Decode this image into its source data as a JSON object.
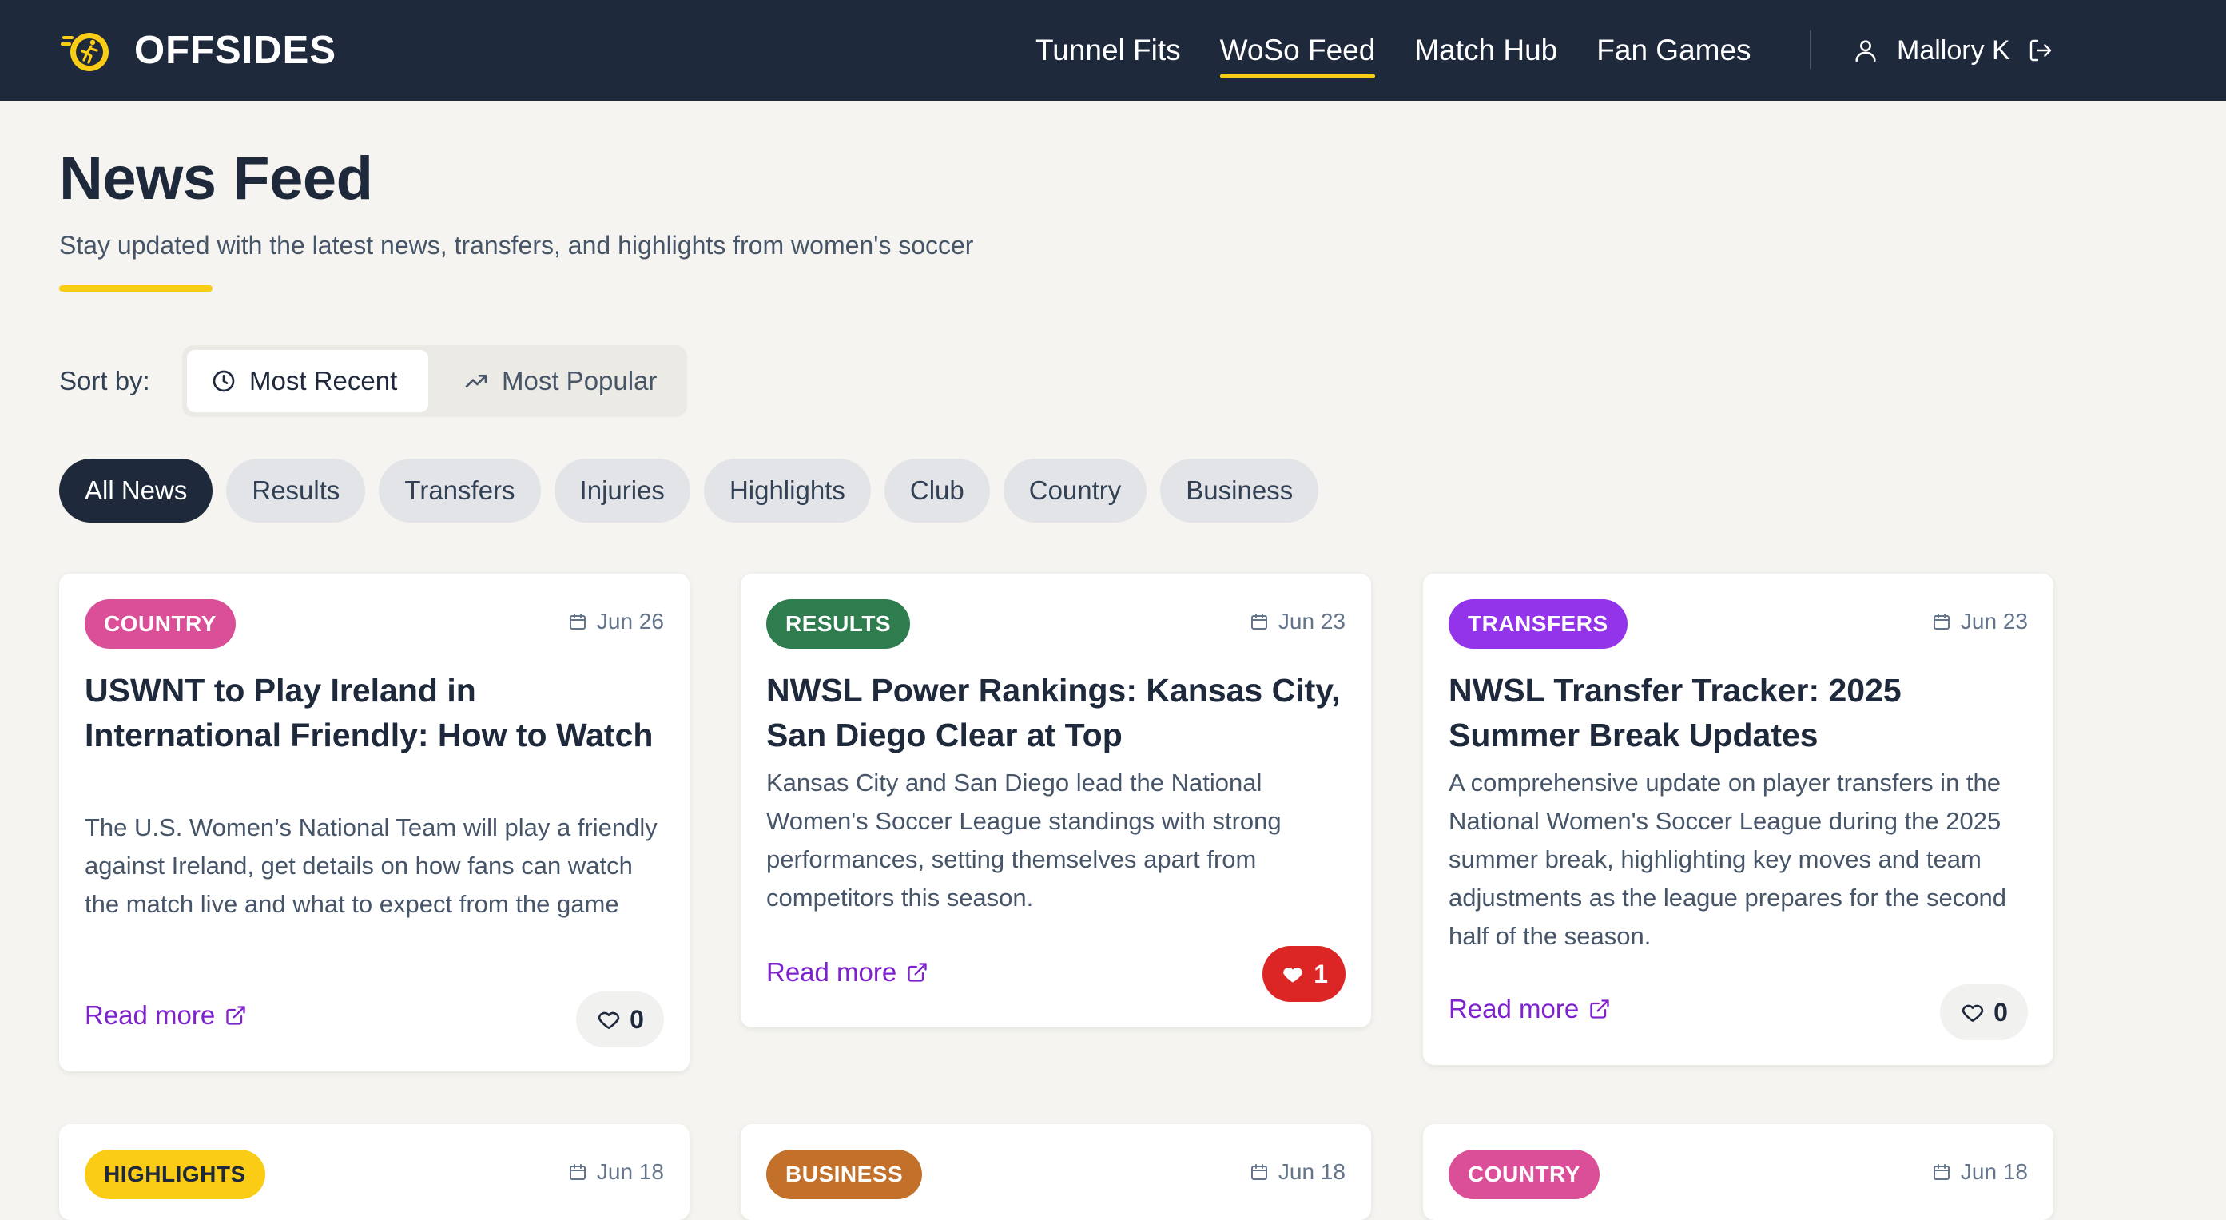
{
  "brand": {
    "name": "OFFSIDES"
  },
  "nav": {
    "items": [
      {
        "label": "Tunnel Fits",
        "active": false
      },
      {
        "label": "WoSo Feed",
        "active": true
      },
      {
        "label": "Match Hub",
        "active": false
      },
      {
        "label": "Fan Games",
        "active": false
      }
    ],
    "user_name": "Mallory K"
  },
  "page": {
    "title": "News Feed",
    "subtitle": "Stay updated with the latest news, transfers, and highlights from women's soccer"
  },
  "sort": {
    "label": "Sort by:",
    "options": [
      {
        "label": "Most Recent",
        "icon": "clock-icon",
        "active": true
      },
      {
        "label": "Most Popular",
        "icon": "trending-up-icon",
        "active": false
      }
    ]
  },
  "filters": [
    "All News",
    "Results",
    "Transfers",
    "Injuries",
    "Highlights",
    "Club",
    "Country",
    "Business"
  ],
  "active_filter": "All News",
  "colors": {
    "header": "#1e293b",
    "accent_yellow": "#facc15",
    "link_purple": "#7e22ce",
    "badge_country": "#db4f98",
    "badge_results": "#2f7d4f",
    "badge_transfers": "#9333ea",
    "badge_highlights": "#facc15",
    "badge_business": "#c2702a",
    "liked_red": "#dc2626"
  },
  "cards": [
    {
      "category": "COUNTRY",
      "date": "Jun 26",
      "title": "USWNT to Play Ireland in International Friendly: How to Watch",
      "description": "The U.S. Women’s National Team will play a friendly against Ireland, get details on how fans can watch the match live and what to expect from the game",
      "read_more": "Read more",
      "likes": "0",
      "liked": false
    },
    {
      "category": "RESULTS",
      "date": "Jun 23",
      "title": "NWSL Power Rankings: Kansas City, San Diego Clear at Top",
      "description": "Kansas City and San Diego lead the National Women's Soccer League standings with strong performances, setting themselves apart from competitors this season.",
      "read_more": "Read more",
      "likes": "1",
      "liked": true
    },
    {
      "category": "TRANSFERS",
      "date": "Jun 23",
      "title": "NWSL Transfer Tracker: 2025 Summer Break Updates",
      "description": "A comprehensive update on player transfers in the National Women's Soccer League during the 2025 summer break, highlighting key moves and team adjustments as the league prepares for the second half of the season.",
      "read_more": "Read more",
      "likes": "0",
      "liked": false
    },
    {
      "category": "HIGHLIGHTS",
      "date": "Jun 18"
    },
    {
      "category": "BUSINESS",
      "date": "Jun 18"
    },
    {
      "category": "COUNTRY",
      "date": "Jun 18"
    }
  ]
}
